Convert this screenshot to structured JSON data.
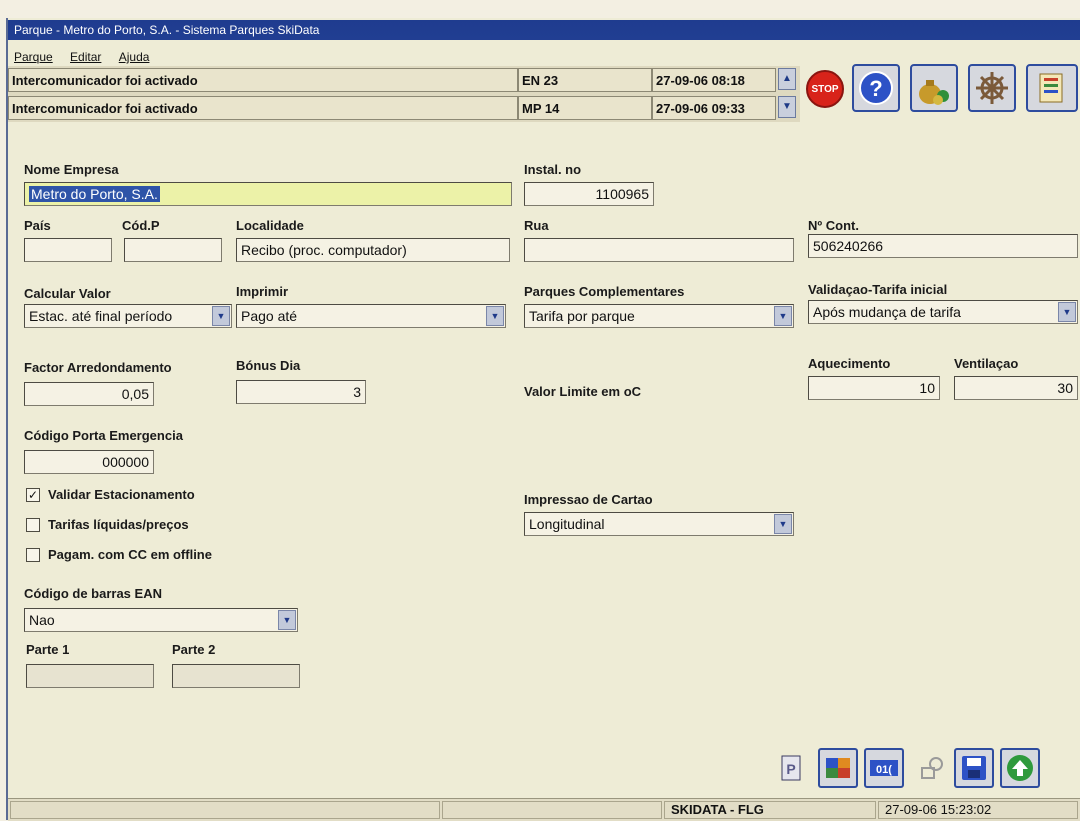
{
  "window": {
    "title": "Parque - Metro do Porto, S.A. - Sistema Parques SkiData"
  },
  "menu": [
    "Parque",
    "Editar",
    "Ajuda"
  ],
  "alarms": [
    {
      "message": "Intercomunicador foi activado",
      "device": "EN 23",
      "timestamp": "27-09-06 08:18"
    },
    {
      "message": "Intercomunicador foi activado",
      "device": "MP 14",
      "timestamp": "27-09-06 09:33"
    }
  ],
  "toolbar": {
    "stop_label": "STOP",
    "icons": [
      "stop-icon",
      "help-icon",
      "money-bag-icon",
      "ship-wheel-icon",
      "report-icon"
    ]
  },
  "form": {
    "nome_empresa": {
      "label": "Nome Empresa",
      "value": "Metro do Porto, S.A."
    },
    "instal_no": {
      "label": "Instal. no",
      "value": "1100965"
    },
    "pais": {
      "label": "País",
      "value": ""
    },
    "cod_p": {
      "label": "Cód.P",
      "value": ""
    },
    "localidade": {
      "label": "Localidade",
      "value": "Recibo (proc. computador)"
    },
    "rua": {
      "label": "Rua",
      "value": ""
    },
    "n_cont": {
      "label": "Nº Cont.",
      "value": "506240266"
    },
    "calcular_valor": {
      "label": "Calcular Valor",
      "value": "Estac. até final período"
    },
    "imprimir": {
      "label": "Imprimir",
      "value": "Pago até"
    },
    "parques_complementares": {
      "label": "Parques Complementares",
      "value": "Tarifa por parque"
    },
    "validacao_tarifa": {
      "label": "Validaçao-Tarifa inicial",
      "value": "Após mudança de tarifa"
    },
    "factor_arredondamento": {
      "label": "Factor Arredondamento",
      "value": "0,05"
    },
    "bonus_dia": {
      "label": "Bónus Dia",
      "value": "3"
    },
    "valor_limite": {
      "label": "Valor Limite em oC"
    },
    "aquecimento": {
      "label": "Aquecimento",
      "value": "10"
    },
    "ventilacao": {
      "label": "Ventilaçao",
      "value": "30"
    },
    "codigo_porta": {
      "label": "Código Porta Emergencia",
      "value": "000000"
    },
    "checks": [
      {
        "label": "Validar Estacionamento",
        "checked": true
      },
      {
        "label": "Tarifas líquidas/preços",
        "checked": false
      },
      {
        "label": "Pagam. com CC em offline",
        "checked": false
      }
    ],
    "impressao_cartao": {
      "label": "Impressao de Cartao",
      "value": "Longitudinal"
    },
    "codigo_barras": {
      "label": "Código de barras EAN",
      "value": "Nao"
    },
    "parte1": {
      "label": "Parte 1",
      "value": ""
    },
    "parte2": {
      "label": "Parte 2",
      "value": ""
    }
  },
  "bottom_icons": [
    "print-icon",
    "tariff-icon",
    "number-icon",
    "key-icon",
    "save-icon",
    "go-icon"
  ],
  "bottom_number_label": "01(",
  "status": {
    "station": "SKIDATA - FLG",
    "datetime": "27-09-06 15:23:02"
  }
}
